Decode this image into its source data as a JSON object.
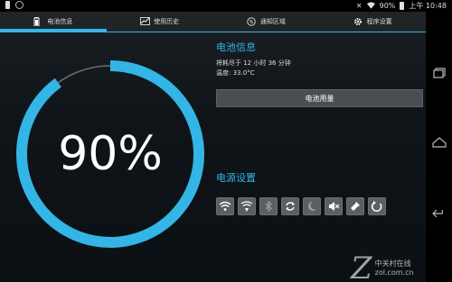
{
  "statusbar": {
    "battery_text": "90%",
    "time_text": "上午 10:48",
    "left_icons": [
      "battery-notification-icon",
      "app-notification-icon"
    ],
    "right_icons": [
      "vibrate-icon",
      "wifi-icon",
      "battery-icon"
    ]
  },
  "tabs": [
    {
      "label": "电池信息",
      "icon": "battery-icon",
      "active": true
    },
    {
      "label": "使用历史",
      "icon": "chart-icon",
      "active": false
    },
    {
      "label": "通知区域",
      "icon": "percent-icon",
      "active": false
    },
    {
      "label": "程序设置",
      "icon": "gear-icon",
      "active": false
    }
  ],
  "gauge": {
    "value_text": "90%",
    "level": 0.9,
    "color": "#33b5e5"
  },
  "battery_info": {
    "title": "电池信息",
    "remaining_line": "将耗尽于 12 小时 36 分钟",
    "temperature_line": "温度: 33.0°C",
    "usage_button_label": "电池用量"
  },
  "power_settings": {
    "title": "电源设置",
    "toggles": [
      "wifi-icon",
      "wifi-hotspot-icon",
      "bluetooth-icon",
      "sync-icon",
      "night-mode-icon",
      "mute-icon",
      "flashlight-icon",
      "rotate-icon"
    ]
  },
  "navbar": {
    "buttons": [
      "recent-apps-icon",
      "home-icon",
      "back-icon"
    ]
  },
  "watermark": {
    "brand_line1": "中关村在线",
    "brand_line2": "zol.com.cn"
  },
  "colors": {
    "accent": "#33b5e5",
    "background": "#0f1418",
    "tabbar": "#202427"
  }
}
